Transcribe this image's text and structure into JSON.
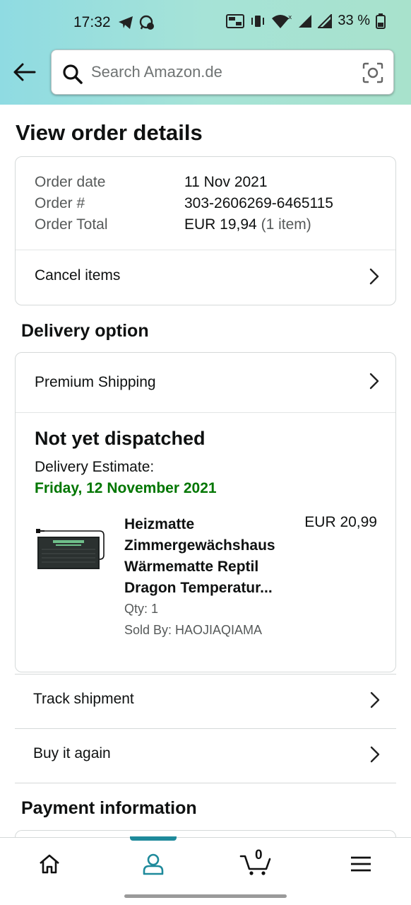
{
  "status_bar": {
    "time": "17:32",
    "battery": "33 %",
    "icons": [
      "telegram-icon",
      "whatsapp-icon",
      "volte-icon",
      "vibrate-icon",
      "wifi-icon",
      "signal-icon",
      "signal-icon",
      "battery-icon"
    ]
  },
  "search": {
    "placeholder": "Search Amazon.de"
  },
  "page": {
    "title": "View order details"
  },
  "order": {
    "date_label": "Order date",
    "date_value": "11 Nov 2021",
    "number_label": "Order #",
    "number_value": "303-2606269-6465115",
    "total_label": "Order Total",
    "total_value": "EUR 19,94",
    "total_items": "(1 item)",
    "cancel_label": "Cancel items"
  },
  "delivery": {
    "section_title": "Delivery option",
    "shipping_label": "Premium Shipping",
    "status": "Not yet dispatched",
    "estimate_label": "Delivery Estimate:",
    "estimate_date": "Friday, 12 November 2021",
    "estimate_color": "#007600",
    "product": {
      "title": "Heizmatte Zimmergewächshaus Wärmematte Reptil Dragon Temperatur...",
      "price": "EUR 20,99",
      "qty": "Qty: 1",
      "seller": "Sold By: HAOJIAQIAMA"
    }
  },
  "actions": {
    "track": "Track shipment",
    "buy_again": "Buy it again"
  },
  "payment": {
    "section_title": "Payment information"
  },
  "bottom_nav": {
    "items": [
      "home-icon",
      "account-icon",
      "cart-icon",
      "menu-icon"
    ],
    "cart_count": "0",
    "active_color": "#1e8a9b"
  }
}
